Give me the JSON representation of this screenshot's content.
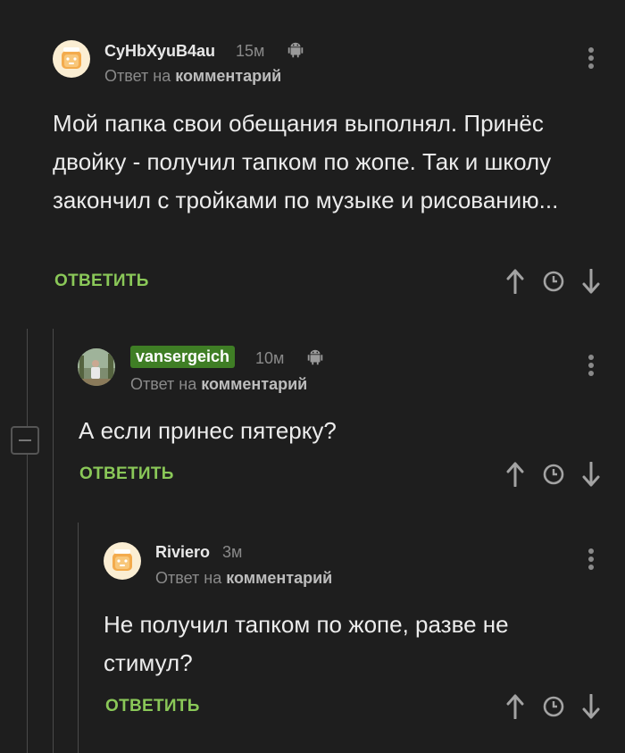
{
  "comments": [
    {
      "author": "CyHbXyuB4au",
      "time": "15м",
      "reply_prefix": "Ответ на",
      "reply_target": "комментарий",
      "text": "Мой папка свои обещания выполнял. Принёс двойку - получил тапком по жопе. Так и школу закончил с тройками по музыке и рисованию...",
      "reply_label": "ОТВЕТИТЬ",
      "platform_icon": "android-icon"
    },
    {
      "author": "vansergeich",
      "author_highlighted": true,
      "time": "10м",
      "reply_prefix": "Ответ на",
      "reply_target": "комментарий",
      "text": "А если принес пятерку?",
      "reply_label": "ОТВЕТИТЬ",
      "platform_icon": "android-icon"
    },
    {
      "author": "Riviero",
      "time": "3м",
      "reply_prefix": "Ответ на",
      "reply_target": "комментарий",
      "text": "Не получил тапком по жопе, разве не стимул?",
      "reply_label": "ОТВЕТИТЬ"
    }
  ],
  "colors": {
    "background": "#1e1e1e",
    "accent_green": "#8ac858",
    "author_badge": "#3f7e25",
    "muted": "#8a8a8a"
  }
}
